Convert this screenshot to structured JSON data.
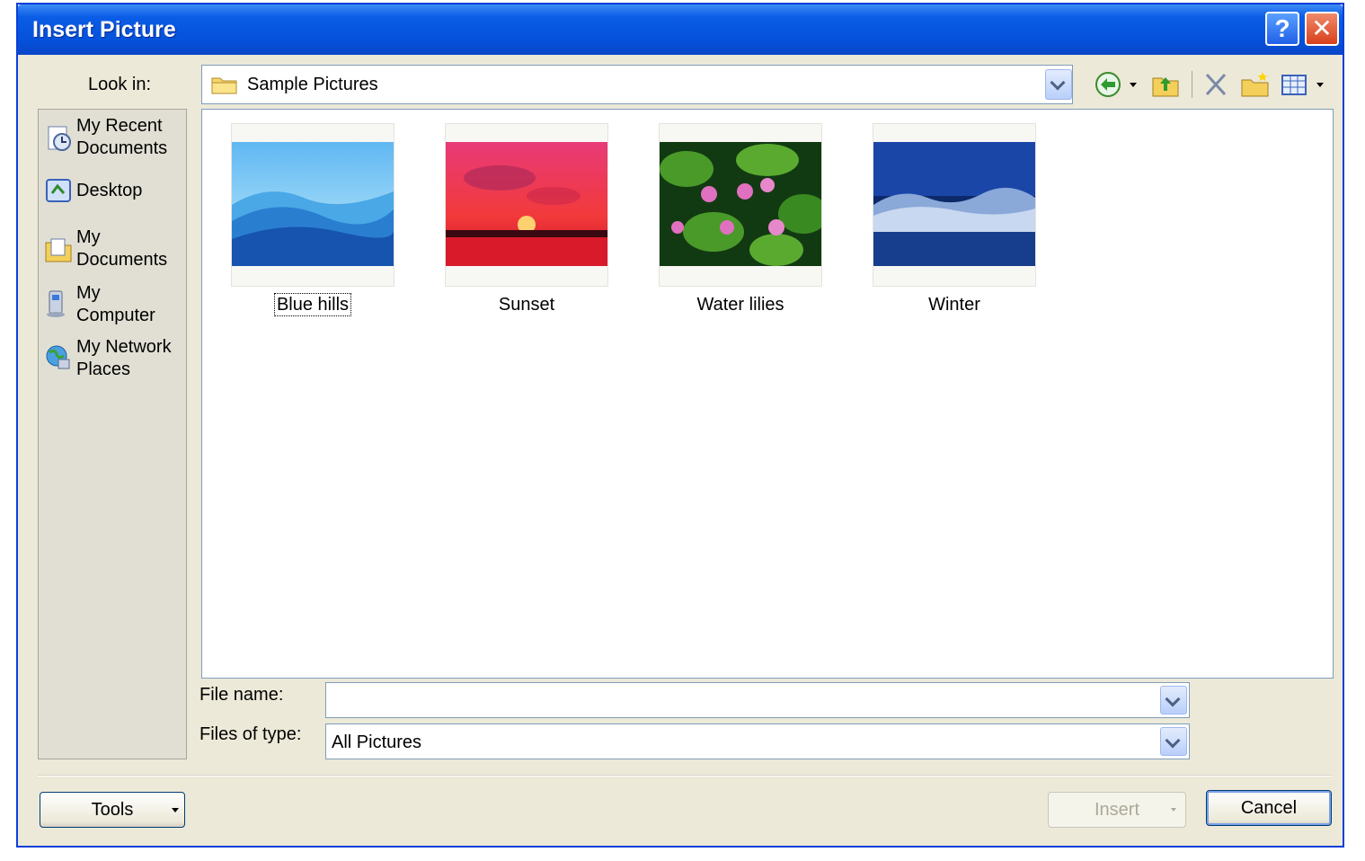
{
  "window": {
    "title": "Insert Picture",
    "help_label": "?",
    "close_label": "✕"
  },
  "lookin": {
    "label": "Look in:",
    "value": "Sample Pictures",
    "icon": "folder-icon"
  },
  "toolbar": {
    "back": "back-icon",
    "up": "up-folder-icon",
    "delete": "delete-icon",
    "new_folder": "new-folder-icon",
    "views": "views-icon"
  },
  "places": [
    {
      "label": "My Recent\nDocuments",
      "icon": "recent-documents-icon"
    },
    {
      "label": "Desktop",
      "icon": "desktop-icon"
    },
    {
      "label": "My\nDocuments",
      "icon": "my-documents-icon"
    },
    {
      "label": "My\nComputer",
      "icon": "my-computer-icon"
    },
    {
      "label": "My Network\nPlaces",
      "icon": "network-places-icon"
    }
  ],
  "files": [
    {
      "name": "Blue hills",
      "selected": true
    },
    {
      "name": "Sunset",
      "selected": false
    },
    {
      "name": "Water lilies",
      "selected": false
    },
    {
      "name": "Winter",
      "selected": false
    }
  ],
  "filename": {
    "label": "File name:",
    "value": ""
  },
  "filetype": {
    "label": "Files of type:",
    "value": "All Pictures"
  },
  "buttons": {
    "tools": "Tools",
    "insert": "Insert",
    "cancel": "Cancel"
  },
  "colors": {
    "title_bar": "#0552db",
    "dialog_bg": "#ece9d8",
    "accent_border": "#0a3fd8"
  }
}
